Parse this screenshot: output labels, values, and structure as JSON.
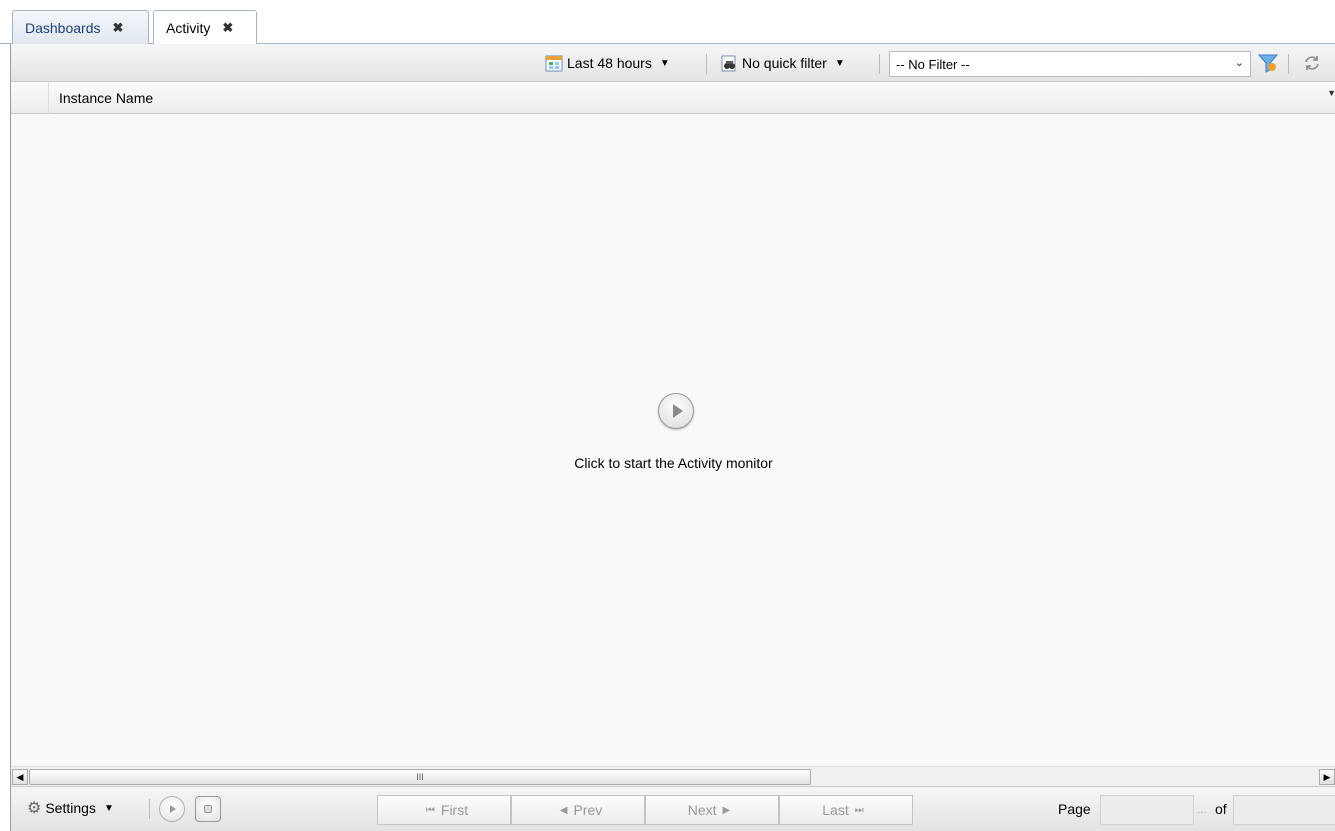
{
  "tabs": [
    {
      "label": "Dashboards",
      "close": "✖"
    },
    {
      "label": "Activity",
      "close": "✖"
    }
  ],
  "toolbar": {
    "time_range": "Last 48 hours",
    "quick_filter": "No quick filter",
    "filter_value": "-- No Filter --"
  },
  "grid": {
    "column_header": "Instance Name",
    "empty_message": "Click to start the Activity monitor"
  },
  "scrollbar": {
    "thumb_mark": "III"
  },
  "bottom": {
    "settings": "Settings",
    "first": "First",
    "prev": "Prev",
    "next": "Next",
    "last": "Last",
    "page_label": "Page",
    "ellipsis": "...",
    "of_label": "of"
  },
  "icons": {
    "calendar": "calendar-icon",
    "quick_filter": "binoculars-icon",
    "filter_funnel": "funnel-icon",
    "refresh": "refresh-icon",
    "settings": "gear-icon"
  },
  "colors": {
    "tab_text": "#1f3f7a",
    "funnel": "#4a90e2"
  }
}
